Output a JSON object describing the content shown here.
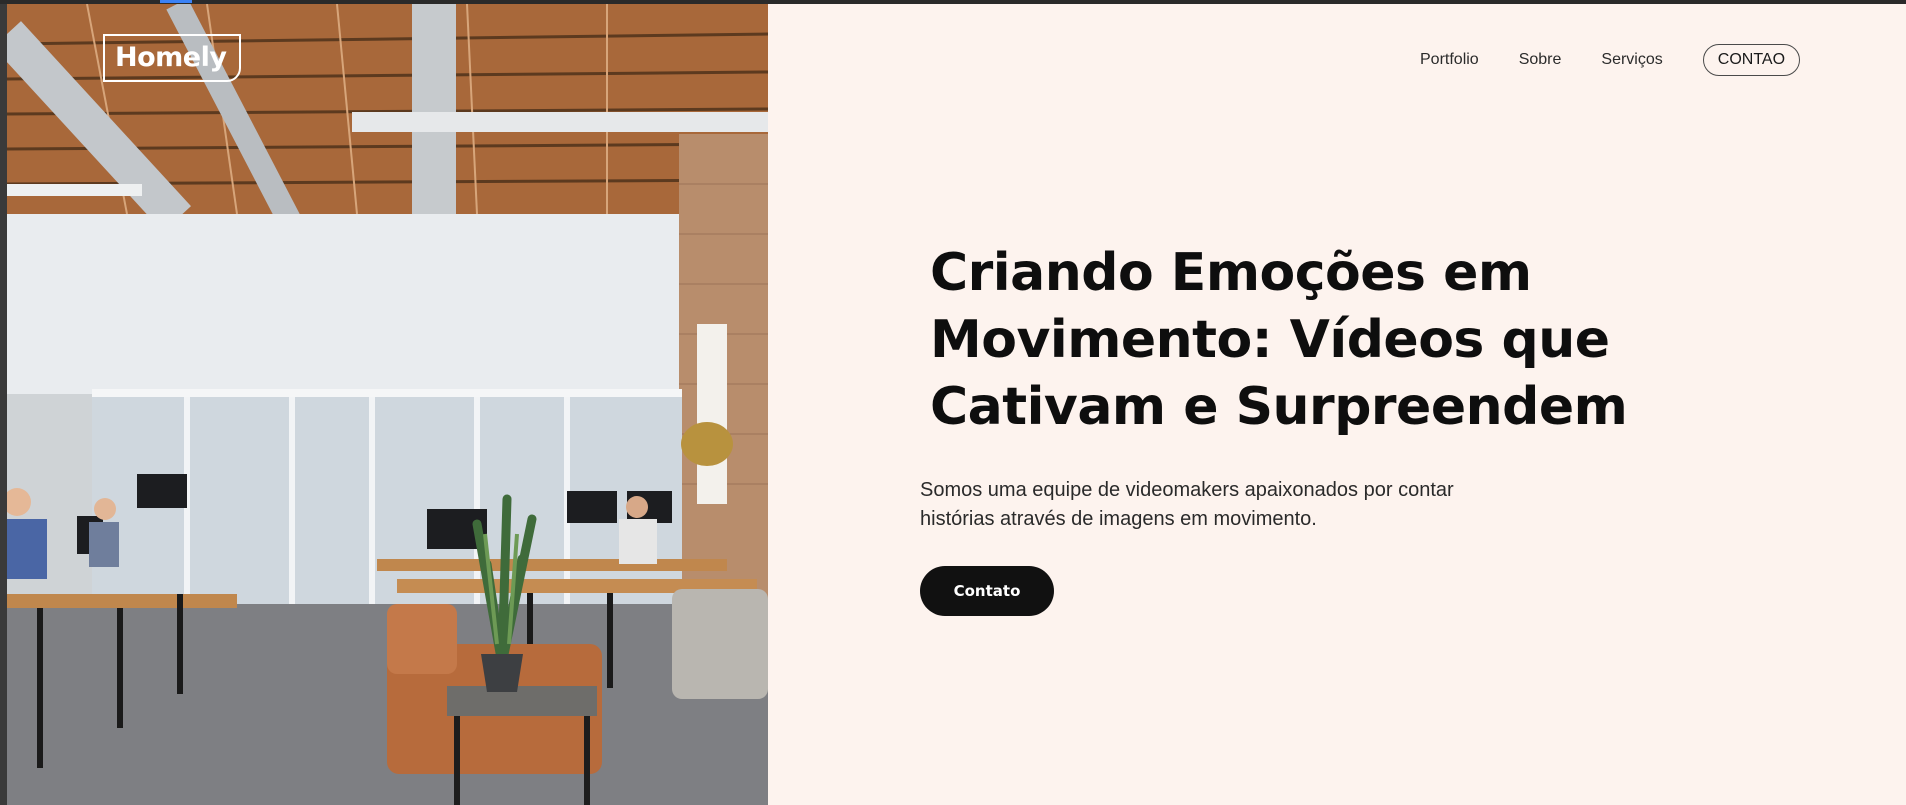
{
  "brand": {
    "logo_text": "Homely"
  },
  "nav": {
    "items": [
      {
        "label": "Portfolio"
      },
      {
        "label": "Sobre"
      },
      {
        "label": "Serviços"
      }
    ],
    "cta_label": "CONTAO"
  },
  "hero": {
    "title": "Criando Emoções em Movimento: Vídeos que Cativam e Surpreendem",
    "subtitle": "Somos uma equipe de videomakers apaixonados por contar histórias através de imagens em movimento.",
    "button_label": "Contato",
    "image_subject": "open-plan office with exposed wooden ceiling, desks, leather sofa and potted plant"
  },
  "colors": {
    "page_background": "#fdf3ee",
    "text_primary": "#0e0e0e",
    "button_background": "#111111",
    "button_text": "#ffffff"
  }
}
